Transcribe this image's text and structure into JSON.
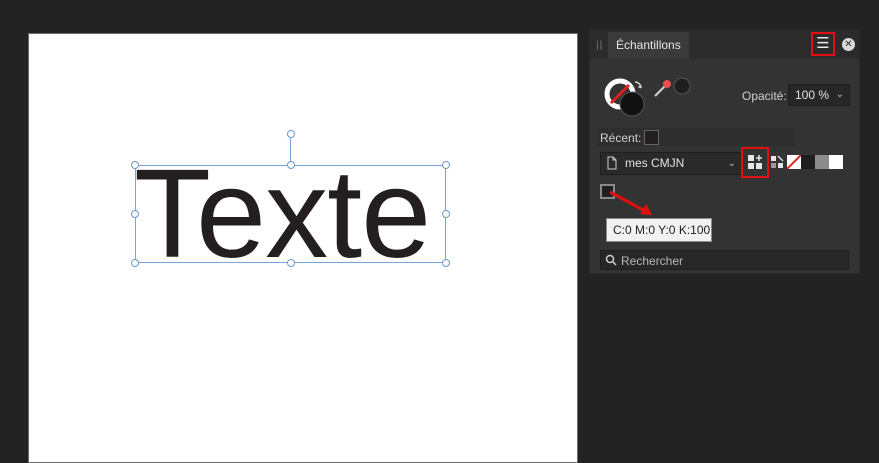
{
  "canvas": {
    "text": "Texte"
  },
  "panel": {
    "tab_label": "Échantillons",
    "menu_icon": "hamburger-icon",
    "close_icon": "close-icon",
    "opacity": {
      "label": "Opacité:",
      "value": "100 %"
    },
    "recent": {
      "label": "Récent:",
      "swatch_color": "#231f20"
    },
    "palette": {
      "name": "mes CMJN"
    },
    "swatch_colors": [
      "#ffffff",
      "#1e1e1e",
      "#8c8c8c",
      "#ffffff"
    ],
    "search": {
      "placeholder": "Rechercher"
    }
  },
  "tooltip": {
    "text": "C:0 M:0 Y:0 K:100"
  },
  "colors": {
    "highlight": "#e01010",
    "selection": "#7da3d6"
  }
}
